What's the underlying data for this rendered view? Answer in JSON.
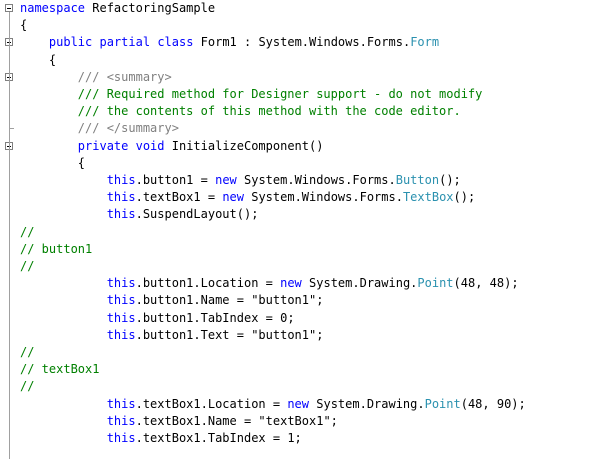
{
  "editor": {
    "colors": {
      "keyword": "#0000ff",
      "comment": "#008000",
      "type": "#2b91af",
      "plain": "#000000",
      "xml_tag": "#808080"
    },
    "lines": [
      [
        {
          "t": "namespace",
          "c": "kw"
        },
        {
          "t": " RefactoringSample",
          "c": "pl"
        }
      ],
      [
        {
          "t": "{",
          "c": "pl"
        }
      ],
      [
        {
          "t": "    ",
          "c": "pl"
        },
        {
          "t": "public",
          "c": "kw"
        },
        {
          "t": " ",
          "c": "pl"
        },
        {
          "t": "partial",
          "c": "kw"
        },
        {
          "t": " ",
          "c": "pl"
        },
        {
          "t": "class",
          "c": "kw"
        },
        {
          "t": " Form1 : System.Windows.Forms.",
          "c": "pl"
        },
        {
          "t": "Form",
          "c": "ty"
        }
      ],
      [
        {
          "t": "    {",
          "c": "pl"
        }
      ],
      [
        {
          "t": "        ",
          "c": "pl"
        },
        {
          "t": "/// ",
          "c": "tag"
        },
        {
          "t": "<summary>",
          "c": "tag"
        }
      ],
      [
        {
          "t": "        ",
          "c": "pl"
        },
        {
          "t": "/// Required method for Designer support - do not modify",
          "c": "cm"
        }
      ],
      [
        {
          "t": "        ",
          "c": "pl"
        },
        {
          "t": "/// the contents of this method with the code editor.",
          "c": "cm"
        }
      ],
      [
        {
          "t": "        ",
          "c": "pl"
        },
        {
          "t": "/// ",
          "c": "tag"
        },
        {
          "t": "</summary>",
          "c": "tag"
        }
      ],
      [
        {
          "t": "        ",
          "c": "pl"
        },
        {
          "t": "private",
          "c": "kw"
        },
        {
          "t": " ",
          "c": "pl"
        },
        {
          "t": "void",
          "c": "kw"
        },
        {
          "t": " InitializeComponent()",
          "c": "pl"
        }
      ],
      [
        {
          "t": "        {",
          "c": "pl"
        }
      ],
      [
        {
          "t": "            ",
          "c": "pl"
        },
        {
          "t": "this",
          "c": "kw"
        },
        {
          "t": ".button1 = ",
          "c": "pl"
        },
        {
          "t": "new",
          "c": "kw"
        },
        {
          "t": " System.Windows.Forms.",
          "c": "pl"
        },
        {
          "t": "Button",
          "c": "ty"
        },
        {
          "t": "();",
          "c": "pl"
        }
      ],
      [
        {
          "t": "            ",
          "c": "pl"
        },
        {
          "t": "this",
          "c": "kw"
        },
        {
          "t": ".textBox1 = ",
          "c": "pl"
        },
        {
          "t": "new",
          "c": "kw"
        },
        {
          "t": " System.Windows.Forms.",
          "c": "pl"
        },
        {
          "t": "TextBox",
          "c": "ty"
        },
        {
          "t": "();",
          "c": "pl"
        }
      ],
      [
        {
          "t": "            ",
          "c": "pl"
        },
        {
          "t": "this",
          "c": "kw"
        },
        {
          "t": ".SuspendLayout();",
          "c": "pl"
        }
      ],
      [
        {
          "t": "//",
          "c": "cm"
        }
      ],
      [
        {
          "t": "// button1",
          "c": "cm"
        }
      ],
      [
        {
          "t": "//",
          "c": "cm"
        }
      ],
      [
        {
          "t": "            ",
          "c": "pl"
        },
        {
          "t": "this",
          "c": "kw"
        },
        {
          "t": ".button1.Location = ",
          "c": "pl"
        },
        {
          "t": "new",
          "c": "kw"
        },
        {
          "t": " System.Drawing.",
          "c": "pl"
        },
        {
          "t": "Point",
          "c": "ty"
        },
        {
          "t": "(48, 48);",
          "c": "pl"
        }
      ],
      [
        {
          "t": "            ",
          "c": "pl"
        },
        {
          "t": "this",
          "c": "kw"
        },
        {
          "t": ".button1.Name = \"button1\";",
          "c": "pl"
        }
      ],
      [
        {
          "t": "            ",
          "c": "pl"
        },
        {
          "t": "this",
          "c": "kw"
        },
        {
          "t": ".button1.TabIndex = 0;",
          "c": "pl"
        }
      ],
      [
        {
          "t": "            ",
          "c": "pl"
        },
        {
          "t": "this",
          "c": "kw"
        },
        {
          "t": ".button1.Text = \"button1\";",
          "c": "pl"
        }
      ],
      [
        {
          "t": "//",
          "c": "cm"
        }
      ],
      [
        {
          "t": "// textBox1",
          "c": "cm"
        }
      ],
      [
        {
          "t": "//",
          "c": "cm"
        }
      ],
      [
        {
          "t": "            ",
          "c": "pl"
        },
        {
          "t": "this",
          "c": "kw"
        },
        {
          "t": ".textBox1.Location = ",
          "c": "pl"
        },
        {
          "t": "new",
          "c": "kw"
        },
        {
          "t": " System.Drawing.",
          "c": "pl"
        },
        {
          "t": "Point",
          "c": "ty"
        },
        {
          "t": "(48, 90);",
          "c": "pl"
        }
      ],
      [
        {
          "t": "            ",
          "c": "pl"
        },
        {
          "t": "this",
          "c": "kw"
        },
        {
          "t": ".textBox1.Name = \"textBox1\";",
          "c": "pl"
        }
      ],
      [
        {
          "t": "            ",
          "c": "pl"
        },
        {
          "t": "this",
          "c": "kw"
        },
        {
          "t": ".textBox1.TabIndex = 1;",
          "c": "pl"
        }
      ]
    ]
  }
}
